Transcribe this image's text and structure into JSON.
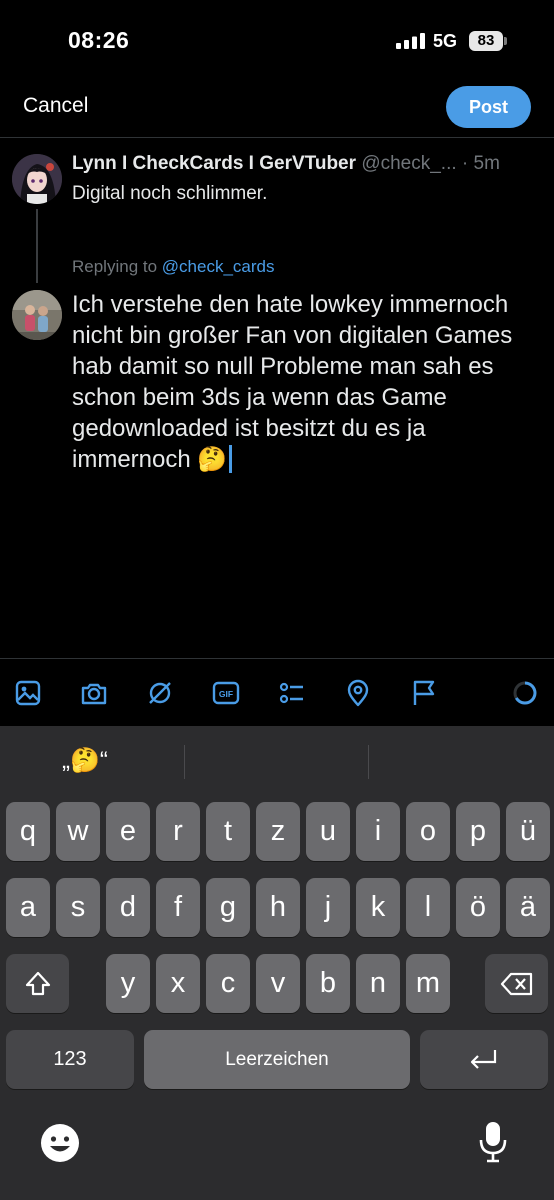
{
  "status_bar": {
    "time": "08:26",
    "network": "5G",
    "battery": "83"
  },
  "nav": {
    "cancel_label": "Cancel",
    "post_label": "Post"
  },
  "quoted_tweet": {
    "author_name": "Lynn I CheckCards I GerVTuber",
    "handle": "@check_...",
    "time_ago": "· 5m",
    "text": "Digital noch schlimmer."
  },
  "reply": {
    "replying_prefix": "Replying to",
    "replying_handle": "@check_cards",
    "text": "Ich verstehe den hate lowkey immernoch nicht bin großer Fan von digitalen Games hab damit so null Probleme man sah es schon beim 3ds ja wenn das Game gedownloaded ist besitzt du es ja immernoch 🤔"
  },
  "toolbar": {
    "icons": [
      "image-icon",
      "camera-icon",
      "grok-icon",
      "gif-icon",
      "poll-icon",
      "location-icon",
      "flag-icon",
      "character-count-icon"
    ],
    "gif_label": "GIF",
    "accent": "#4a9ce6"
  },
  "keyboard": {
    "suggestion": "„🤔“",
    "row1": [
      "q",
      "w",
      "e",
      "r",
      "t",
      "z",
      "u",
      "i",
      "o",
      "p",
      "ü"
    ],
    "row2": [
      "a",
      "s",
      "d",
      "f",
      "g",
      "h",
      "j",
      "k",
      "l",
      "ö",
      "ä"
    ],
    "row3": [
      "y",
      "x",
      "c",
      "v",
      "b",
      "n",
      "m"
    ],
    "numbers_label": "123",
    "space_label": "Leerzeichen",
    "icons": [
      "shift-icon",
      "backspace-icon",
      "return-icon",
      "emoji-icon",
      "microphone-icon"
    ]
  }
}
